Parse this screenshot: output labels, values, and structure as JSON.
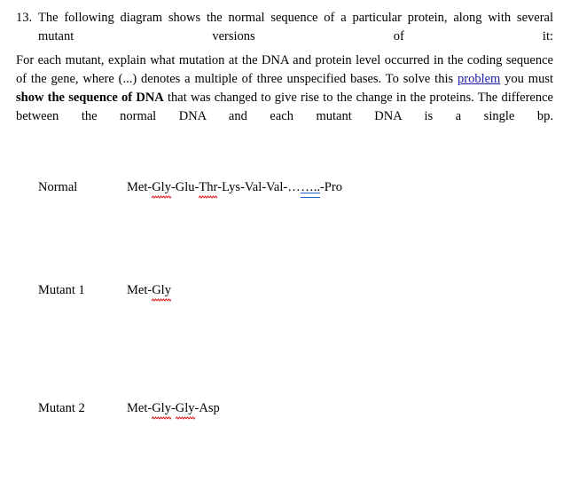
{
  "document": {
    "question": {
      "number": "13.",
      "text": "The following diagram shows the normal sequence of a particular protein, along with several mutant versions of it:"
    },
    "instructions": {
      "part1": "For each mutant, explain what mutation at the DNA and protein level occurred in the coding sequence of the gene, where (...) denotes a multiple of three unspecified bases. To solve this ",
      "link_text": "problem",
      "part2": " you must ",
      "bold_text": "show the sequence of DNA",
      "part3": " that was changed to give rise to the change in the proteins. The difference between the normal DNA and each mutant DNA is a single bp."
    },
    "sequences": [
      {
        "label": "Normal",
        "prefix": "Met-",
        "residue1": "Gly",
        "mid1": "-Glu-",
        "residue2": "Thr",
        "mid2": "-Lys-Val-Val-",
        "ellipsis_plain": "…",
        "ellipsis_marked": "…..",
        "suffix": "-Pro",
        "full_text": "Met-Gly-Glu-Thr-Lys-Val-Val-……-Pro"
      },
      {
        "label": "Mutant 1",
        "prefix": "Met-",
        "residue1": "Gly",
        "full_text": "Met-Gly"
      },
      {
        "label": "Mutant 2",
        "prefix": "Met-",
        "residue1": "Gly",
        "mid1": "-",
        "residue2": "Gly",
        "suffix": "-Asp",
        "full_text": "Met-Gly-Gly-Asp"
      }
    ],
    "colors": {
      "text": "#000000",
      "background": "#ffffff",
      "hyperlink": "#1c1ca8",
      "spellcheck_underline": "#e01b1b",
      "grammar_underline": "#2b5fd0"
    }
  }
}
